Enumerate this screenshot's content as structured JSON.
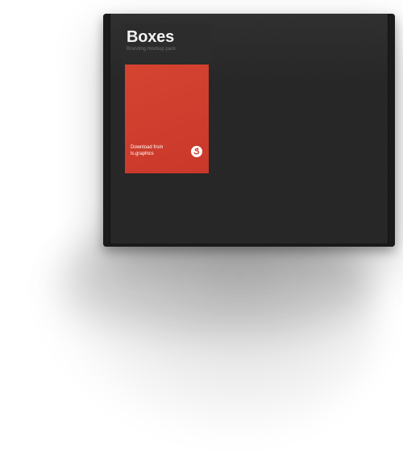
{
  "box": {
    "title": "Boxes",
    "subtitle": "Branding mockup pack",
    "label": {
      "line1": "Download from",
      "line2": "ls.graphics"
    },
    "logo_icon": "ls-graphics-logo-icon"
  },
  "colors": {
    "box": "#262626",
    "label": "#cf3b29",
    "background": "#ffffff"
  }
}
